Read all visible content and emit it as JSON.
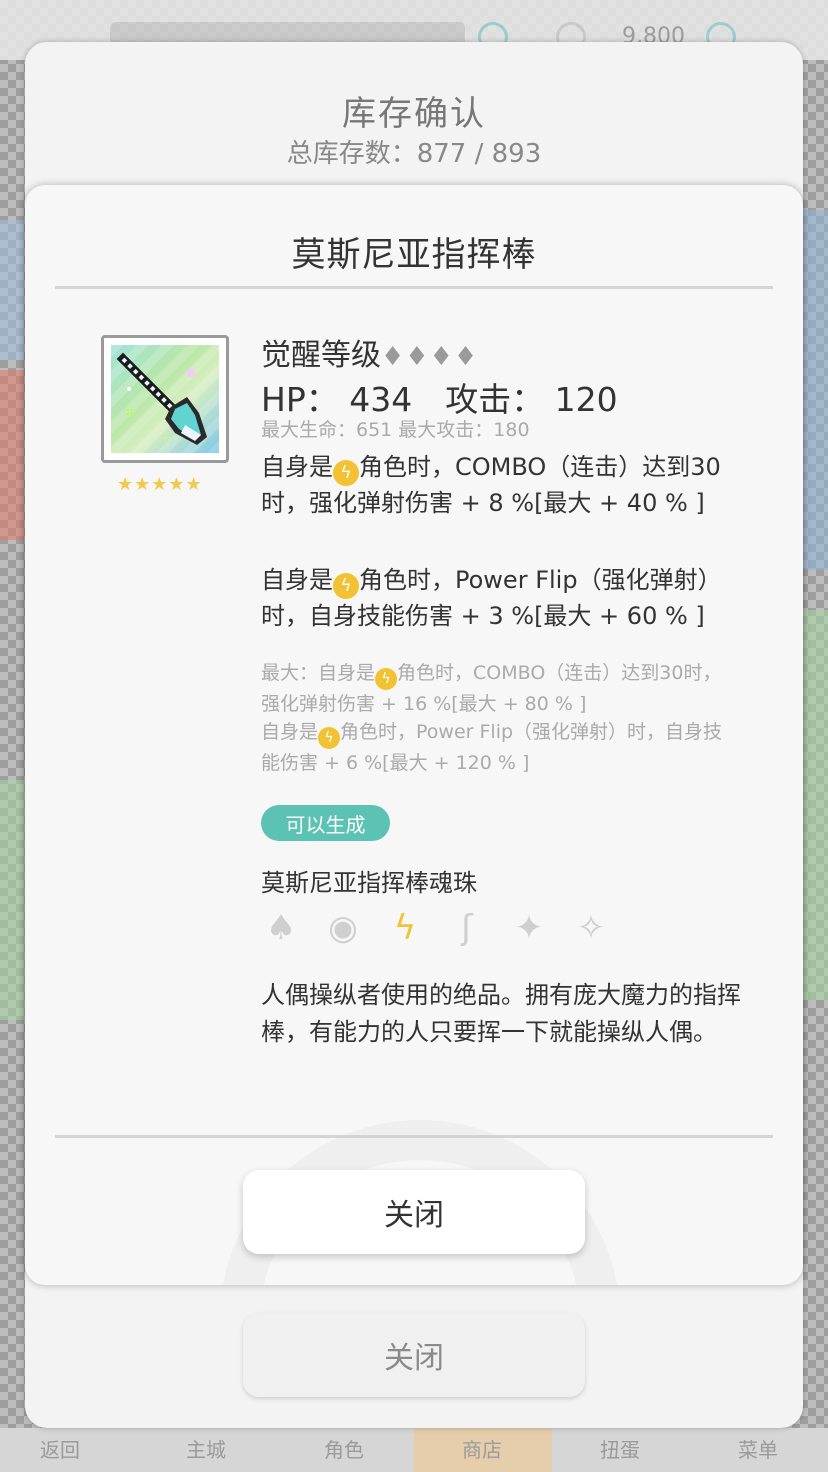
{
  "background_ui": {
    "top_amount": "9,800",
    "nav_items": [
      "返回",
      "主城",
      "角色",
      "商店",
      "扭蛋",
      "菜单"
    ],
    "active_nav": "商店"
  },
  "outer_dialog": {
    "title": "库存确认",
    "subtitle": "总库存数：877 / 893",
    "close_label": "关闭"
  },
  "item_dialog": {
    "item_name": "莫斯尼亚指挥棒",
    "rarity_stars": "★★★★★",
    "awaken_label": "觉醒等级",
    "awaken_diamonds": "♦♦♦♦",
    "stats_line": "HP： 434　攻击： 120",
    "max_stats_line": "最大生命：651  最大攻击：180",
    "skill1": {
      "prefix": "自身是",
      "icon": "lightning-bolt",
      "suffix": "角色时，COMBO（连击）达到30时，强化弹射伤害 + 8 %[最大 + 40 % ]"
    },
    "skill2": {
      "prefix": "自身是",
      "icon": "lightning-bolt",
      "suffix": "角色时，Power Flip（强化弹射）时，自身技能伤害 + 3 %[最大 + 60 % ]"
    },
    "max_skill1": {
      "prefix": "最大：自身是",
      "suffix": "角色时，COMBO（连击）达到30时，强化弹射伤害 + 16 %[最大 + 80 % ]"
    },
    "max_skill2": {
      "prefix": "自身是",
      "suffix": "角色时，Power Flip（强化弹射）时，自身技能伤害 + 6 %[最大 + 120 % ]"
    },
    "craft_badge": "可以生成",
    "soul_name": "莫斯尼亚指挥棒魂珠",
    "elements": [
      {
        "name": "fire-icon",
        "glyph": "♠",
        "active": false
      },
      {
        "name": "water-icon",
        "glyph": "◉",
        "active": false
      },
      {
        "name": "lightning-icon",
        "glyph": "ϟ",
        "active": true
      },
      {
        "name": "wind-icon",
        "glyph": "ʃ",
        "active": false
      },
      {
        "name": "light-icon",
        "glyph": "✦",
        "active": false
      },
      {
        "name": "dark-icon",
        "glyph": "✧",
        "active": false
      }
    ],
    "description": "人偶操纵者使用的绝品。拥有庞大魔力的指挥棒，有能力的人只要挥一下就能操纵人偶。",
    "close_label": "关闭",
    "colors": {
      "badge": "#5cc3b4",
      "lightning": "#f2c232"
    }
  }
}
